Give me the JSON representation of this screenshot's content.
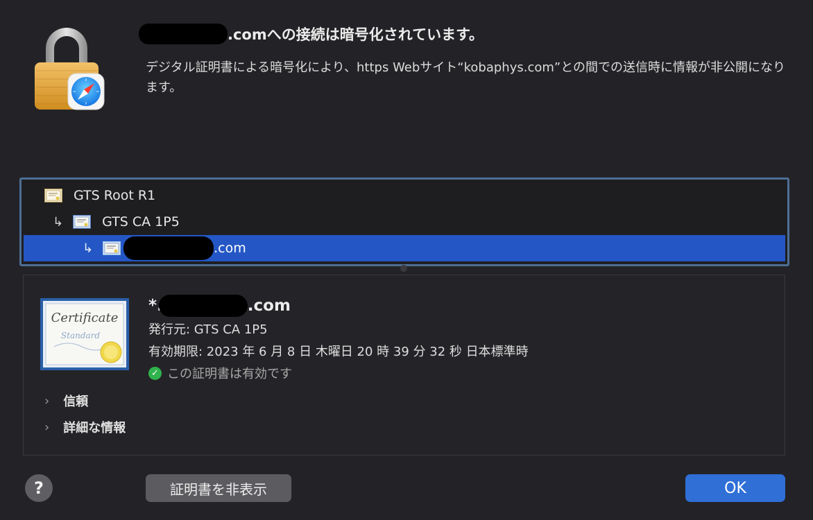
{
  "header": {
    "title_suffix": ".comへの接続は暗号化されています。",
    "description": "デジタル証明書による暗号化により、https Webサイト“kobaphys.com”との間での送信時に情報が非公開になります。"
  },
  "chain": {
    "items": [
      {
        "label": "GTS Root R1"
      },
      {
        "label": "GTS CA 1P5"
      },
      {
        "label": ".com"
      }
    ]
  },
  "certificate": {
    "name_prefix": "*.",
    "name_suffix": ".com",
    "issuer": "発行元: GTS CA 1P5",
    "expiry": "有効期限: 2023 年 6 月 8 日 木曜日 20 時 39 分 32 秒 日本標準時",
    "status": "この証明書は有効です",
    "sections": [
      {
        "label": "信頼"
      },
      {
        "label": "詳細な情報"
      }
    ]
  },
  "footer": {
    "help_label": "?",
    "hide_label": "証明書を非表示",
    "ok_label": "OK"
  },
  "colors": {
    "accent": "#2f6fd6",
    "selection": "#2457c5",
    "valid": "#30b34c",
    "background": "#232327"
  },
  "icons": [
    "lock-safari-icon",
    "certificate-icon",
    "checkmark-icon",
    "chevron-right-icon",
    "help-icon"
  ]
}
